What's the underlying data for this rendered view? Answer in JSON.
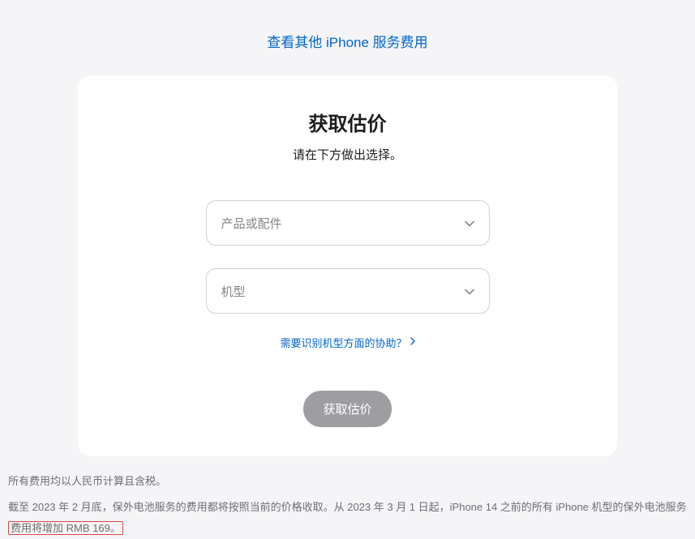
{
  "topLink": {
    "label": "查看其他 iPhone 服务费用"
  },
  "card": {
    "title": "获取估价",
    "subtitle": "请在下方做出选择。",
    "select1Placeholder": "产品或配件",
    "select2Placeholder": "机型",
    "helpLink": "需要识别机型方面的协助？",
    "submitLabel": "获取估价"
  },
  "footer": {
    "line1": "所有费用均以人民币计算且含税。",
    "line2a": "截至 2023 年 2 月底，保外电池服务的费用都将按照当前的价格收取。从 2023 年 3 月 1 日起，iPhone 14 之前的所有 iPhone 机型的保外电池服务",
    "line2b": "费用将增加 RMB 169。"
  }
}
